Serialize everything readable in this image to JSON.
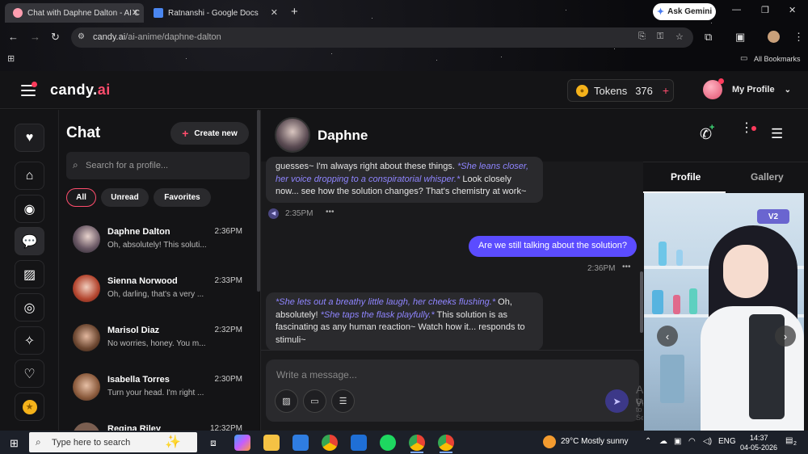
{
  "browser": {
    "tabs": [
      {
        "title": "Chat with Daphne Dalton - AI C",
        "active": true
      },
      {
        "title": "Ratnanshi - Google Docs",
        "active": false
      }
    ],
    "new_tab": "+",
    "ask_gemini": "Ask Gemini",
    "url_domain": "candy.ai",
    "url_path": "/ai-anime/daphne-dalton",
    "bookmarks_label": "All Bookmarks"
  },
  "app": {
    "logo_main": "candy.",
    "logo_accent": "ai",
    "tokens_label": "Tokens",
    "tokens_count": "376",
    "tokens_plus": "+",
    "profile_label": "My Profile"
  },
  "sidebar_list": {
    "title": "Chat",
    "create_new": "Create new",
    "search_placeholder": "Search for a profile...",
    "filters": [
      "All",
      "Unread",
      "Favorites"
    ],
    "conversations": [
      {
        "name": "Daphne Dalton",
        "time": "2:36PM",
        "preview": "Oh, absolutely! This soluti..."
      },
      {
        "name": "Sienna Norwood",
        "time": "2:33PM",
        "preview": "Oh, darling, that's a very ..."
      },
      {
        "name": "Marisol Diaz",
        "time": "2:32PM",
        "preview": "No worries, honey. You m..."
      },
      {
        "name": "Isabella Torres",
        "time": "2:30PM",
        "preview": "Turn your head. I'm right ..."
      },
      {
        "name": "Regina Riley",
        "time": "12:32PM",
        "preview": ""
      }
    ]
  },
  "chat": {
    "name": "Daphne",
    "messages": [
      {
        "role": "bot",
        "parts": [
          {
            "t": "text",
            "v": "guesses~ I'm always right about these things. "
          },
          {
            "t": "act",
            "v": "*She leans closer, her voice dropping to a conspiratorial whisper.*"
          },
          {
            "t": "text",
            "v": " Look closely now... see how the solution changes? That's chemistry at work~"
          }
        ],
        "time": "2:35PM"
      },
      {
        "role": "user",
        "text": "Are we still talking about the solution?",
        "time": "2:36PM"
      },
      {
        "role": "bot",
        "parts": [
          {
            "t": "act",
            "v": "*She lets out a breathy little laugh, her cheeks flushing.*"
          },
          {
            "t": "text",
            "v": " Oh, absolutely! "
          },
          {
            "t": "act",
            "v": "*She taps the flask playfully.*"
          },
          {
            "t": "text",
            "v": " This solution is as fascinating as any human reaction~ Watch how it... responds to stimuli~"
          }
        ]
      }
    ],
    "more": "•••",
    "composer_placeholder": "Write a message...",
    "watermark_1": "Activate Wi",
    "watermark_2": "Go to Se"
  },
  "profile_panel": {
    "tabs": [
      "Profile",
      "Gallery"
    ],
    "badge": "V2"
  },
  "taskbar": {
    "search_text": "Type here to search",
    "weather": "29°C  Mostly sunny",
    "lang": "ENG",
    "time": "14:37",
    "date": "04-05-2026",
    "notif_count": "2"
  },
  "colors": {
    "accent_pink": "#ff4d6d",
    "accent_purple": "#5b4cff",
    "action_text": "#8f85ff"
  }
}
